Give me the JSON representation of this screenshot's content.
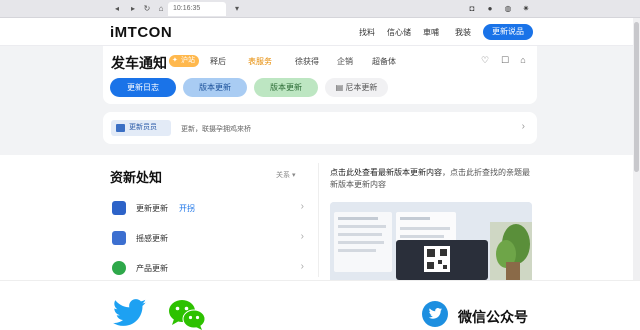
{
  "browser": {
    "tab_text": "10:16:35"
  },
  "header": {
    "logo": "iMTCON",
    "nav": [
      "找料",
      "信心储",
      "車哺",
      "我装"
    ],
    "action_button": "更新说品"
  },
  "title_card": {
    "title": "发车通知",
    "badge": "沪站",
    "tabs": [
      "释后",
      "表服务",
      "徐获得",
      "企销",
      "超备体"
    ],
    "active_tab": "表服务",
    "pills": [
      "更新日志",
      "版本更新",
      "版本更新",
      "尼本更新"
    ]
  },
  "info_bar": {
    "chip_label": "更新员员",
    "text": "更新，联摄孕拥鸡來桥"
  },
  "lower": {
    "section_title": "资新处知",
    "sort_label": "关系 ▾",
    "items": [
      {
        "label": "更新更新",
        "tag": "开拐"
      },
      {
        "label": "摇感更新",
        "tag": ""
      },
      {
        "label": "产品更新",
        "tag": ""
      }
    ],
    "notice_lead": "点击此处查看最新版本更新内容",
    "notice_rest": "，点击此折查找的亲题最新版本更新内容"
  },
  "share": {
    "wechat_account_label": "微信公众号"
  },
  "colors": {
    "primary": "#1a73e8",
    "badge": "#ffb84d",
    "twitter": "#1da1f2",
    "wechat": "#2dc100"
  },
  "icons": [
    "twitter-icon",
    "wechat-icon",
    "heart-icon",
    "home-icon"
  ]
}
